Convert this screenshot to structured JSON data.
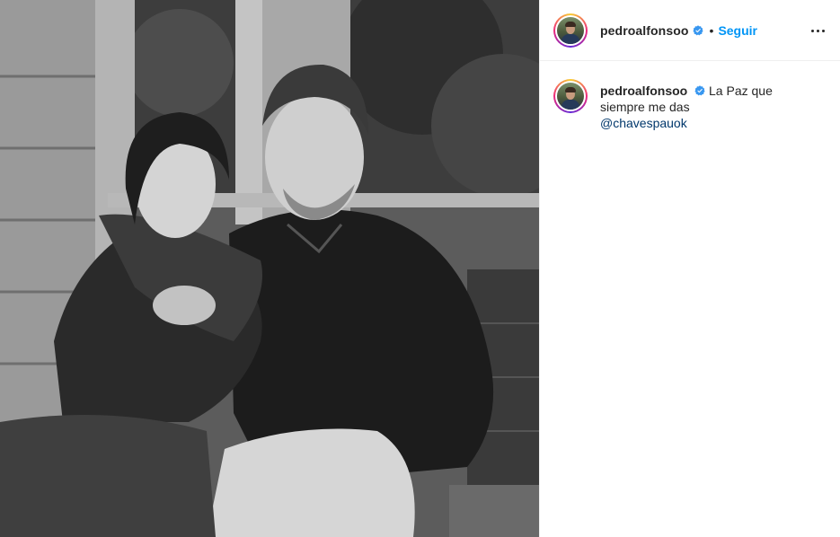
{
  "post": {
    "image_alt": "Black and white photo of a couple sitting on a wooden bench",
    "header": {
      "username": "pedroalfonsoo",
      "verified_icon": "verified-badge-icon",
      "separator": "•",
      "follow_label": "Seguir",
      "more_icon": "more-options-icon"
    },
    "caption": {
      "username": "pedroalfonsoo",
      "line1": "La Paz que",
      "line2": "siempre me das",
      "mention": "@chavespauok"
    },
    "colors": {
      "accent": "#0095f6",
      "mention": "#00376b",
      "text": "#262626",
      "border": "#efefef"
    }
  }
}
